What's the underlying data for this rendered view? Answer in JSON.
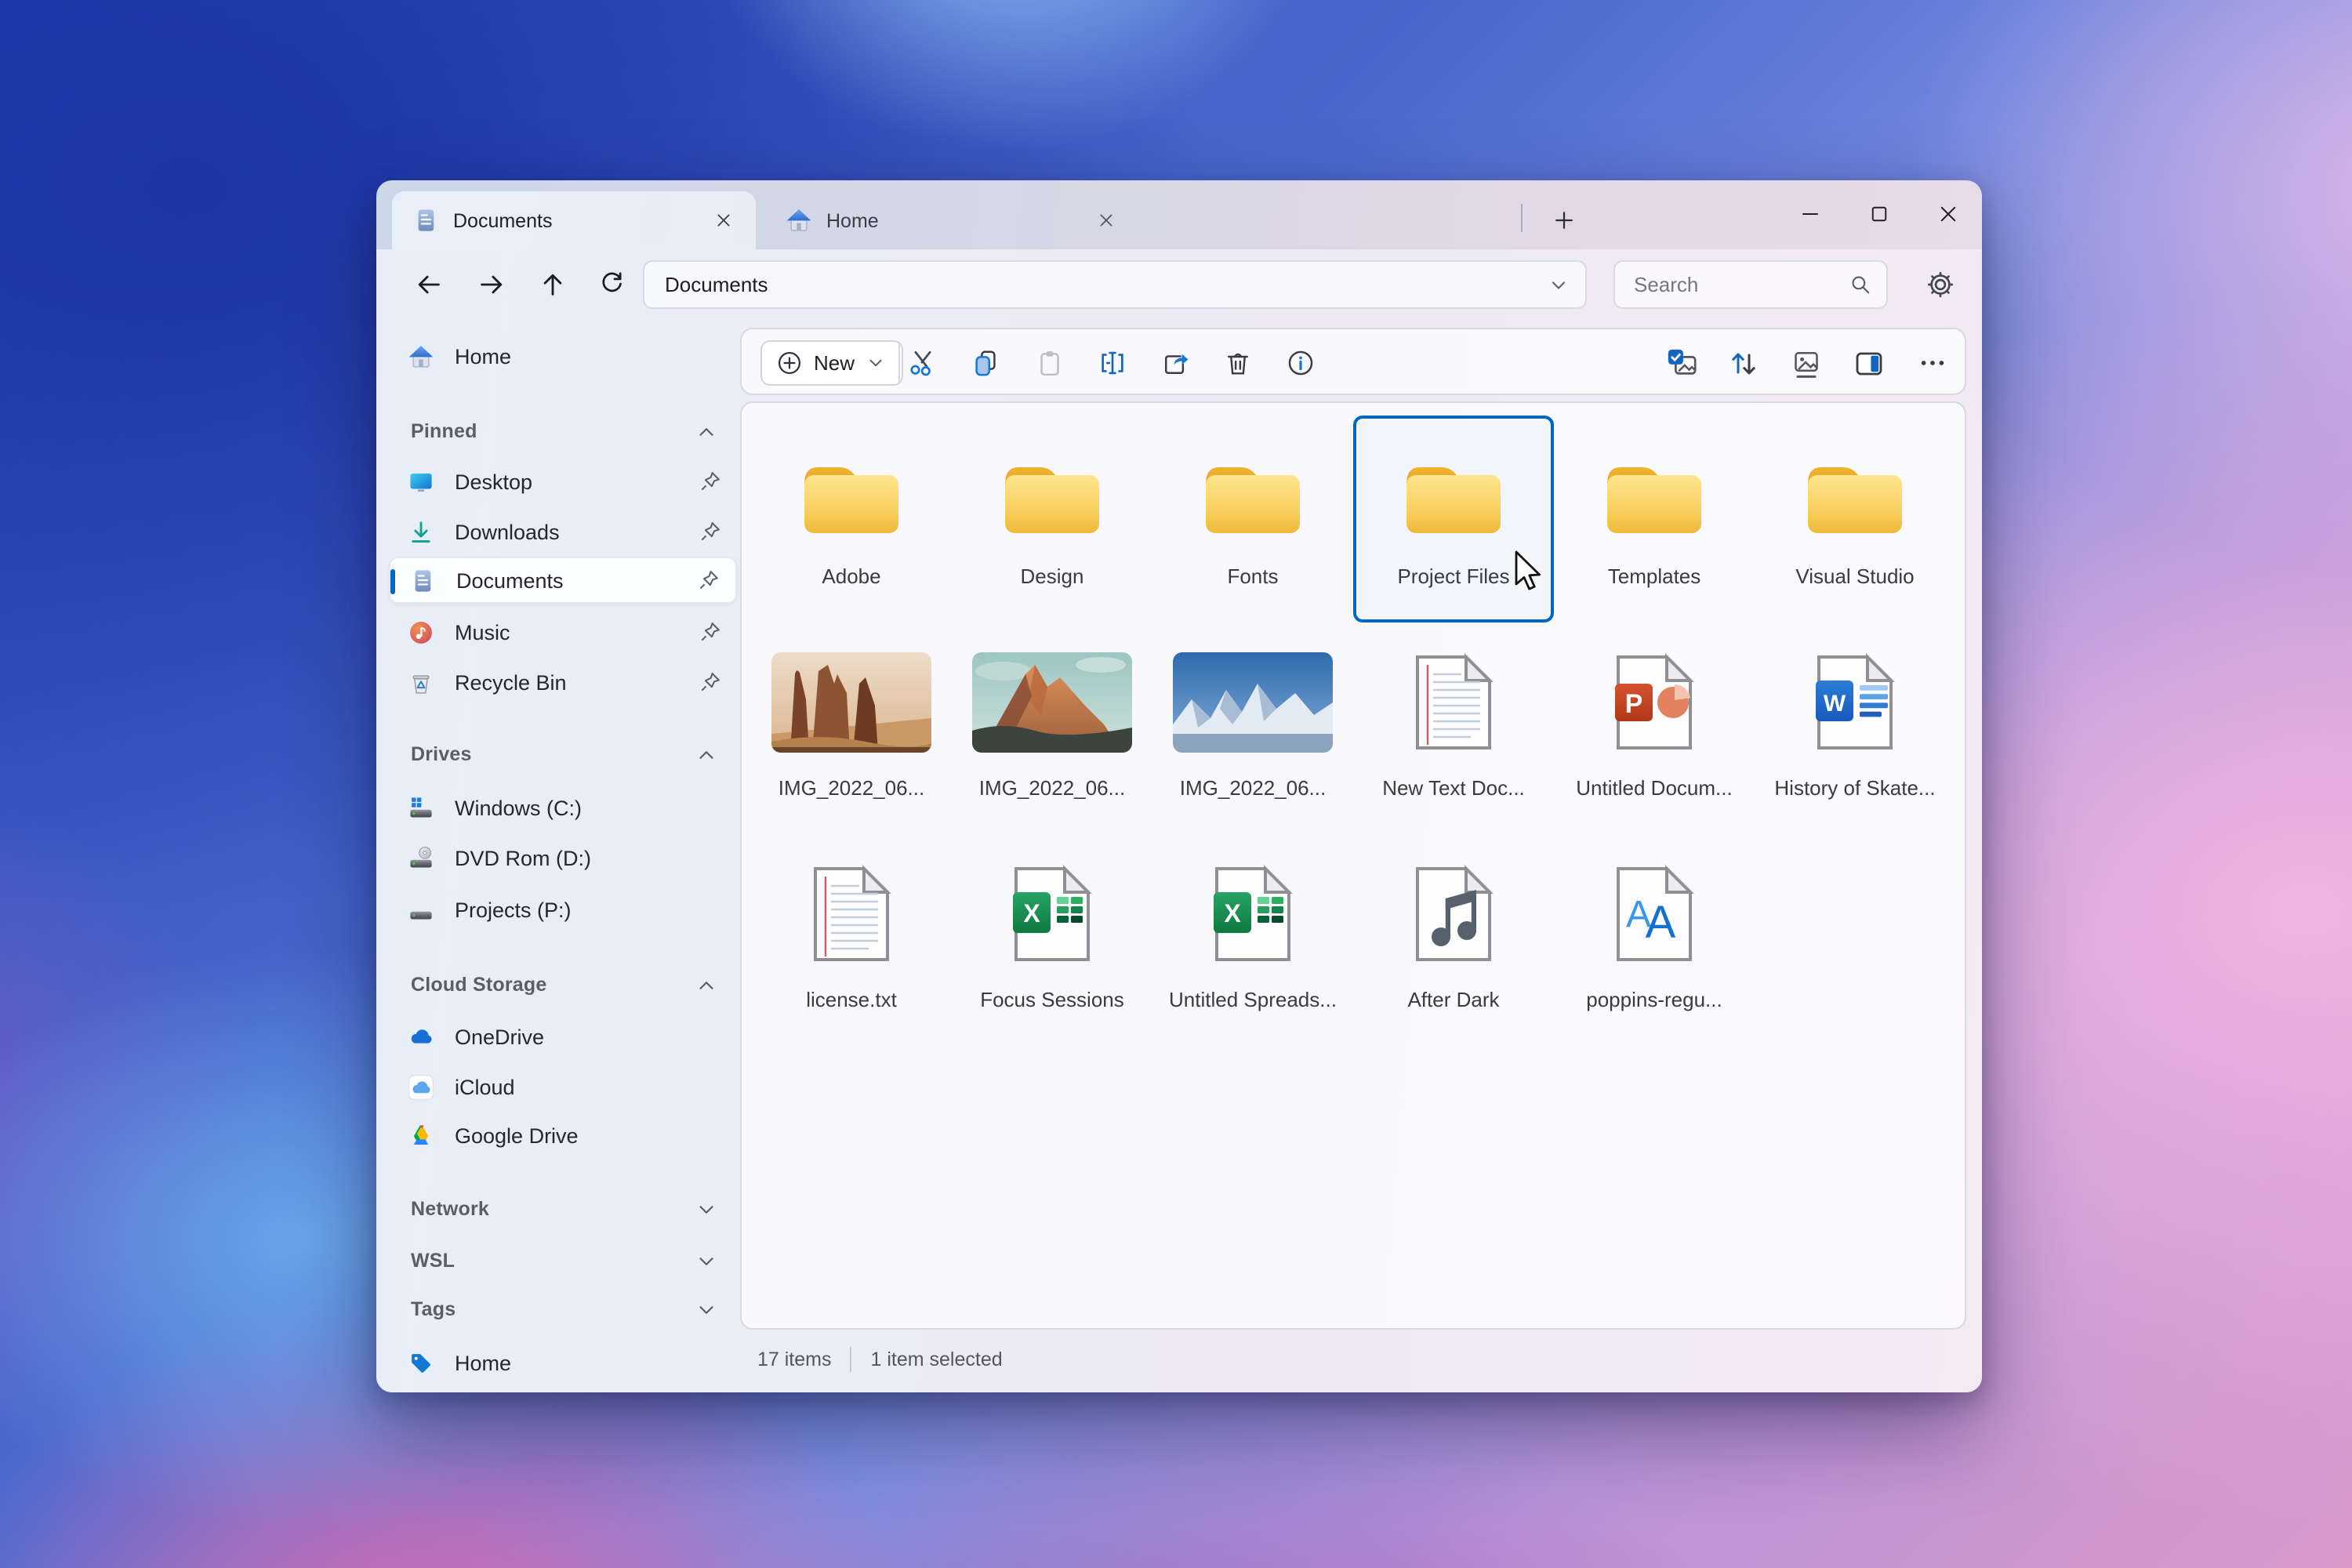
{
  "colors": {
    "accent": "#0067c0",
    "folder_yellow": "#f6c445",
    "excel_green": "#107c41",
    "word_blue": "#185abd",
    "powerpoint_red": "#c8401e"
  },
  "tabs": [
    {
      "label": "Documents",
      "active": true
    },
    {
      "label": "Home",
      "active": false
    }
  ],
  "navigation": {
    "address": "Documents",
    "search_placeholder": "Search"
  },
  "toolbar": {
    "new_label": "New"
  },
  "sidebar": {
    "home_label": "Home",
    "sections": [
      {
        "title": "Pinned",
        "items": [
          "Desktop",
          "Downloads",
          "Documents",
          "Music",
          "Recycle Bin"
        ],
        "selected_item": "Documents"
      },
      {
        "title": "Drives",
        "items": [
          "Windows (C:)",
          "DVD Rom (D:)",
          "Projects (P:)"
        ]
      },
      {
        "title": "Cloud Storage",
        "items": [
          "OneDrive",
          "iCloud",
          "Google Drive"
        ]
      },
      {
        "title": "Network",
        "items": []
      },
      {
        "title": "WSL",
        "items": []
      },
      {
        "title": "Tags",
        "items": [
          "Home"
        ]
      }
    ]
  },
  "files": {
    "selected_item": "Project Files",
    "items": [
      "Adobe",
      "Design",
      "Fonts",
      "Project Files",
      "Templates",
      "Visual Studio",
      "IMG_2022_06...",
      "IMG_2022_06...",
      "IMG_2022_06...",
      "New Text Doc...",
      "Untitled Docum...",
      "History of Skate...",
      "license.txt",
      "Focus Sessions",
      "Untitled Spreads...",
      "After Dark",
      "poppins-regu..."
    ]
  },
  "status_bar": {
    "count": "17 items",
    "selected": "1 item selected"
  }
}
